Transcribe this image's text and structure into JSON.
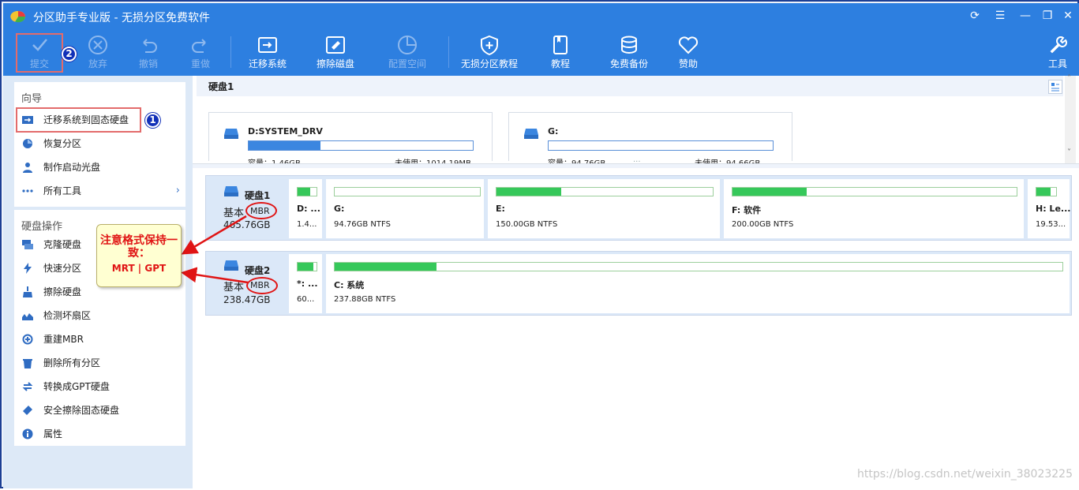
{
  "app": {
    "title": "分区助手专业版 - 无损分区免费软件"
  },
  "toolbar": {
    "commit": "提交",
    "discard": "放弃",
    "undo": "撤销",
    "redo": "重做",
    "migrate": "迁移系统",
    "wipe_disk": "擦除磁盘",
    "allocate": "配置空间",
    "tutorial_lossless": "无损分区教程",
    "tutorial": "教程",
    "backup": "免费备份",
    "donate": "赞助",
    "tools": "工具"
  },
  "badges": {
    "one": "1",
    "two": "2"
  },
  "sidebar": {
    "wizard_title": "向导",
    "wizard_items": [
      {
        "label": "迁移系统到固态硬盘"
      },
      {
        "label": "恢复分区"
      },
      {
        "label": "制作启动光盘"
      },
      {
        "label": "所有工具"
      }
    ],
    "disk_ops_title": "硬盘操作",
    "disk_ops_items": [
      {
        "label": "克隆硬盘"
      },
      {
        "label": "快速分区"
      },
      {
        "label": "擦除硬盘"
      },
      {
        "label": "检测坏扇区"
      },
      {
        "label": "重建MBR"
      },
      {
        "label": "删除所有分区"
      },
      {
        "label": "转换成GPT硬盘"
      },
      {
        "label": "安全擦除固态硬盘"
      },
      {
        "label": "属性"
      }
    ]
  },
  "top_pane": {
    "disk_title": "硬盘1",
    "partitions": [
      {
        "name": "D:SYSTEM_DRV",
        "capacity": "容量：1.46GB",
        "unused": "未使用：1014.19MB",
        "used_fraction": 0.32
      },
      {
        "name": "G:",
        "capacity": "容量：94.76GB",
        "unused": "未使用：94.66GB",
        "used_fraction": 0.0
      }
    ]
  },
  "disks": [
    {
      "name": "硬盘1",
      "type": "基本",
      "style": "MBR",
      "size": "465.76GB",
      "partitions": [
        {
          "name": "D: ...",
          "detail": "1.4...",
          "used_fraction": 0.68
        },
        {
          "name": "G:",
          "detail": "94.76GB NTFS",
          "used_fraction": 0.0
        },
        {
          "name": "E:",
          "detail": "150.00GB NTFS",
          "used_fraction": 0.3
        },
        {
          "name": "F: 软件",
          "detail": "200.00GB NTFS",
          "used_fraction": 0.26
        },
        {
          "name": "H: Le...",
          "detail": "19.53...",
          "used_fraction": 0.7
        }
      ]
    },
    {
      "name": "硬盘2",
      "type": "基本",
      "style": "MBR",
      "size": "238.47GB",
      "partitions": [
        {
          "name": "*: ...",
          "detail": "60...",
          "used_fraction": 0.85
        },
        {
          "name": "C: 系统",
          "detail": "237.88GB NTFS",
          "used_fraction": 0.14
        }
      ]
    }
  ],
  "annotation": {
    "line1": "注意格式保持一致：",
    "line2": "MRT | GPT"
  },
  "watermark": "https://blog.csdn.net/weixin_38023225",
  "colors": {
    "accent": "#2d7fe0",
    "used_bar_blue": "#3b86e0",
    "used_bar_green": "#36c85a",
    "annotation_red": "#e01414"
  }
}
